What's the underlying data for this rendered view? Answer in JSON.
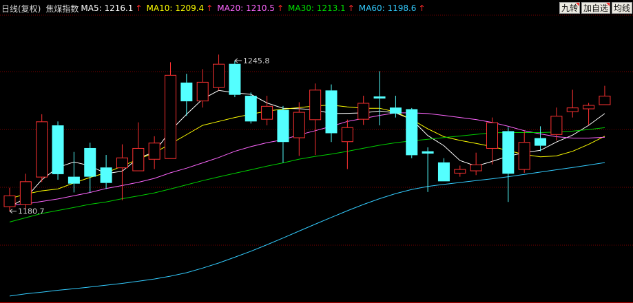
{
  "header": {
    "period": "日线(复权)",
    "name": "焦煤指数",
    "ma": [
      {
        "label": "MA5:",
        "value": "1216.1",
        "color": "#ffffff"
      },
      {
        "label": "MA10:",
        "value": "1209.4",
        "color": "#ffff00"
      },
      {
        "label": "MA20:",
        "value": "1210.5",
        "color": "#ff66ff"
      },
      {
        "label": "MA30:",
        "value": "1213.1",
        "color": "#00e000"
      },
      {
        "label": "MA60:",
        "value": "1198.6",
        "color": "#33ccff"
      }
    ],
    "arrow": "↑"
  },
  "buttons": [
    "九转",
    "加自选",
    "均线"
  ],
  "colors": {
    "up": "#ff3232",
    "down": "#54ffff",
    "grid": "#7a0000",
    "ma5": "#ffffff",
    "ma10": "#ffff00",
    "ma20": "#ff66ff",
    "ma30": "#00d000",
    "ma60": "#33ccff",
    "annotation": "#d0d0d0"
  },
  "chart_data": {
    "type": "candlestick",
    "title": "焦煤指数",
    "ylim": [
      1141,
      1272
    ],
    "grid": "horizontal dotted",
    "annotations": [
      {
        "text": "1245.8",
        "kind": "high",
        "index": 14
      },
      {
        "text": "1180.7",
        "kind": "low",
        "index": 0
      }
    ],
    "candles": [
      {
        "o": 1182.5,
        "c": 1187.5,
        "h": 1190.8,
        "l": 1180.7
      },
      {
        "o": 1183.5,
        "c": 1193.6,
        "h": 1196.9,
        "l": 1181.7
      },
      {
        "o": 1195.3,
        "c": 1219.5,
        "h": 1222.6,
        "l": 1193.3
      },
      {
        "o": 1217.8,
        "c": 1196.7,
        "h": 1219.5,
        "l": 1194.3
      },
      {
        "o": 1195.6,
        "c": 1192.6,
        "h": 1206.3,
        "l": 1188.8
      },
      {
        "o": 1208.0,
        "c": 1195.6,
        "h": 1210.3,
        "l": 1188.8
      },
      {
        "o": 1199.6,
        "c": 1192.9,
        "h": 1205.0,
        "l": 1190.3
      },
      {
        "o": 1199.3,
        "c": 1203.9,
        "h": 1209.6,
        "l": 1185.4
      },
      {
        "o": 1198.0,
        "c": 1208.0,
        "h": 1219.1,
        "l": 1198.0
      },
      {
        "o": 1203.0,
        "c": 1210.3,
        "h": 1213.1,
        "l": 1198.9
      },
      {
        "o": 1203.3,
        "c": 1239.6,
        "h": 1245.1,
        "l": 1203.3
      },
      {
        "o": 1236.3,
        "c": 1228.2,
        "h": 1240.1,
        "l": 1221.9
      },
      {
        "o": 1228.2,
        "c": 1236.6,
        "h": 1242.1,
        "l": 1225.5
      },
      {
        "o": 1234.0,
        "c": 1244.4,
        "h": 1248.4,
        "l": 1232.9
      },
      {
        "o": 1244.4,
        "c": 1231.0,
        "h": 1245.8,
        "l": 1230.0
      },
      {
        "o": 1230.6,
        "c": 1219.5,
        "h": 1232.0,
        "l": 1218.6
      },
      {
        "o": 1220.3,
        "c": 1226.2,
        "h": 1230.6,
        "l": 1217.8
      },
      {
        "o": 1224.5,
        "c": 1210.6,
        "h": 1226.2,
        "l": 1201.6
      },
      {
        "o": 1212.3,
        "c": 1223.6,
        "h": 1227.8,
        "l": 1204.6
      },
      {
        "o": 1220.1,
        "c": 1233.2,
        "h": 1235.9,
        "l": 1205.0
      },
      {
        "o": 1232.9,
        "c": 1214.4,
        "h": 1235.5,
        "l": 1210.6
      },
      {
        "o": 1210.6,
        "c": 1217.0,
        "h": 1220.3,
        "l": 1198.9
      },
      {
        "o": 1220.3,
        "c": 1227.5,
        "h": 1230.6,
        "l": 1218.0
      },
      {
        "o": 1230.3,
        "c": 1229.4,
        "h": 1241.2,
        "l": 1217.8
      },
      {
        "o": 1225.5,
        "c": 1222.9,
        "h": 1230.6,
        "l": 1221.2
      },
      {
        "o": 1224.8,
        "c": 1204.9,
        "h": 1225.3,
        "l": 1203.6
      },
      {
        "o": 1206.6,
        "c": 1205.6,
        "h": 1208.3,
        "l": 1189.0
      },
      {
        "o": 1201.8,
        "c": 1193.6,
        "h": 1203.6,
        "l": 1193.6
      },
      {
        "o": 1197.0,
        "c": 1198.9,
        "h": 1200.4,
        "l": 1195.6
      },
      {
        "o": 1198.0,
        "c": 1200.9,
        "h": 1206.0,
        "l": 1196.3
      },
      {
        "o": 1207.7,
        "c": 1219.1,
        "h": 1221.2,
        "l": 1200.9
      },
      {
        "o": 1215.3,
        "c": 1196.9,
        "h": 1217.0,
        "l": 1184.7
      },
      {
        "o": 1198.6,
        "c": 1210.6,
        "h": 1215.3,
        "l": 1197.3
      },
      {
        "o": 1212.3,
        "c": 1209.0,
        "h": 1217.4,
        "l": 1206.6
      },
      {
        "o": 1213.7,
        "c": 1221.9,
        "h": 1225.5,
        "l": 1211.3
      },
      {
        "o": 1223.6,
        "c": 1225.5,
        "h": 1233.2,
        "l": 1221.2
      },
      {
        "o": 1224.8,
        "c": 1226.6,
        "h": 1227.5,
        "l": 1218.0
      },
      {
        "o": 1226.6,
        "c": 1230.6,
        "h": 1234.9,
        "l": 1226.6
      }
    ],
    "ma_series": [
      {
        "name": "MA5",
        "color_key": "ma5",
        "points": [
          [
            0,
            1182.6
          ],
          [
            1,
            1186.4
          ],
          [
            2,
            1194.3
          ],
          [
            3,
            1199.6
          ],
          [
            4,
            1202.0
          ],
          [
            5,
            1200.3
          ],
          [
            6,
            1196.9
          ],
          [
            7,
            1198.0
          ],
          [
            8,
            1203.6
          ],
          [
            9,
            1206.3
          ],
          [
            10,
            1215.5
          ],
          [
            11,
            1222.6
          ],
          [
            12,
            1229.2
          ],
          [
            13,
            1232.9
          ],
          [
            14,
            1231.9
          ],
          [
            15,
            1231.2
          ],
          [
            16,
            1227.5
          ],
          [
            17,
            1225.2
          ],
          [
            18,
            1225.0
          ],
          [
            19,
            1224.5
          ],
          [
            20,
            1222.9
          ],
          [
            21,
            1223.0
          ],
          [
            22,
            1223.2
          ],
          [
            23,
            1224.0
          ],
          [
            24,
            1223.2
          ],
          [
            25,
            1220.3
          ],
          [
            26,
            1213.4
          ],
          [
            27,
            1209.0
          ],
          [
            28,
            1202.6
          ],
          [
            29,
            1200.2
          ],
          [
            30,
            1202.2
          ],
          [
            31,
            1204.5
          ],
          [
            32,
            1206.0
          ],
          [
            33,
            1207.0
          ],
          [
            34,
            1210.6
          ],
          [
            35,
            1213.6
          ],
          [
            36,
            1217.8
          ],
          [
            37,
            1222.9
          ]
        ]
      },
      {
        "name": "MA10",
        "color_key": "ma10",
        "points": [
          [
            0,
            1186.1
          ],
          [
            1,
            1188.1
          ],
          [
            2,
            1189.5
          ],
          [
            3,
            1190.3
          ],
          [
            4,
            1192.9
          ],
          [
            5,
            1195.3
          ],
          [
            6,
            1197.3
          ],
          [
            7,
            1200.2
          ],
          [
            8,
            1203.2
          ],
          [
            9,
            1206.0
          ],
          [
            10,
            1209.8
          ],
          [
            11,
            1213.8
          ],
          [
            12,
            1217.8
          ],
          [
            13,
            1219.5
          ],
          [
            14,
            1221.2
          ],
          [
            15,
            1222.6
          ],
          [
            16,
            1224.0
          ],
          [
            17,
            1224.8
          ],
          [
            18,
            1225.5
          ],
          [
            19,
            1226.2
          ],
          [
            20,
            1226.6
          ],
          [
            21,
            1225.8
          ],
          [
            22,
            1225.2
          ],
          [
            23,
            1225.2
          ],
          [
            24,
            1223.6
          ],
          [
            25,
            1220.3
          ],
          [
            26,
            1216.3
          ],
          [
            27,
            1212.9
          ],
          [
            28,
            1211.3
          ],
          [
            29,
            1210.0
          ],
          [
            30,
            1208.6
          ],
          [
            31,
            1206.9
          ],
          [
            32,
            1205.2
          ],
          [
            33,
            1204.2
          ],
          [
            34,
            1204.6
          ],
          [
            35,
            1206.6
          ],
          [
            36,
            1209.6
          ],
          [
            37,
            1213.1
          ]
        ]
      },
      {
        "name": "MA20",
        "color_key": "ma20",
        "points": [
          [
            0,
            1183.3
          ],
          [
            1,
            1183.8
          ],
          [
            2,
            1184.9
          ],
          [
            3,
            1186.0
          ],
          [
            4,
            1187.4
          ],
          [
            5,
            1188.8
          ],
          [
            6,
            1190.5
          ],
          [
            7,
            1191.8
          ],
          [
            8,
            1193.2
          ],
          [
            9,
            1194.9
          ],
          [
            10,
            1197.3
          ],
          [
            11,
            1199.3
          ],
          [
            12,
            1201.6
          ],
          [
            13,
            1203.9
          ],
          [
            14,
            1206.6
          ],
          [
            15,
            1208.6
          ],
          [
            16,
            1210.3
          ],
          [
            17,
            1211.6
          ],
          [
            18,
            1213.7
          ],
          [
            19,
            1215.5
          ],
          [
            20,
            1217.4
          ],
          [
            21,
            1219.5
          ],
          [
            22,
            1220.8
          ],
          [
            23,
            1222.1
          ],
          [
            24,
            1223.2
          ],
          [
            25,
            1223.2
          ],
          [
            26,
            1222.9
          ],
          [
            27,
            1222.1
          ],
          [
            28,
            1221.2
          ],
          [
            29,
            1220.3
          ],
          [
            30,
            1219.1
          ],
          [
            31,
            1217.4
          ],
          [
            32,
            1215.5
          ],
          [
            33,
            1214.1
          ],
          [
            34,
            1212.9
          ],
          [
            35,
            1212.3
          ],
          [
            36,
            1212.3
          ],
          [
            37,
            1212.7
          ]
        ]
      },
      {
        "name": "MA30",
        "color_key": "ma30",
        "points": [
          [
            0,
            1176.0
          ],
          [
            1,
            1177.9
          ],
          [
            2,
            1179.7
          ],
          [
            3,
            1181.0
          ],
          [
            4,
            1182.3
          ],
          [
            5,
            1183.7
          ],
          [
            6,
            1184.7
          ],
          [
            7,
            1186.1
          ],
          [
            8,
            1187.3
          ],
          [
            9,
            1188.6
          ],
          [
            10,
            1190.3
          ],
          [
            11,
            1192.1
          ],
          [
            12,
            1193.9
          ],
          [
            13,
            1195.5
          ],
          [
            14,
            1197.1
          ],
          [
            15,
            1198.6
          ],
          [
            16,
            1200.2
          ],
          [
            17,
            1201.6
          ],
          [
            18,
            1203.2
          ],
          [
            19,
            1204.4
          ],
          [
            20,
            1205.4
          ],
          [
            21,
            1206.6
          ],
          [
            22,
            1207.9
          ],
          [
            23,
            1209.2
          ],
          [
            24,
            1210.3
          ],
          [
            25,
            1211.1
          ],
          [
            26,
            1211.8
          ],
          [
            27,
            1212.5
          ],
          [
            28,
            1213.2
          ],
          [
            29,
            1213.9
          ],
          [
            30,
            1214.6
          ],
          [
            31,
            1214.7
          ],
          [
            32,
            1214.7
          ],
          [
            33,
            1214.7
          ],
          [
            34,
            1214.9
          ],
          [
            35,
            1215.3
          ],
          [
            36,
            1216.0
          ],
          [
            37,
            1216.8
          ]
        ]
      },
      {
        "name": "MA60",
        "color_key": "ma60",
        "points": [
          [
            0,
            1144.0
          ],
          [
            1,
            1145.0
          ],
          [
            2,
            1145.7
          ],
          [
            3,
            1146.5
          ],
          [
            4,
            1147.2
          ],
          [
            5,
            1147.9
          ],
          [
            6,
            1148.7
          ],
          [
            7,
            1149.5
          ],
          [
            8,
            1150.4
          ],
          [
            9,
            1151.4
          ],
          [
            10,
            1152.6
          ],
          [
            11,
            1154.1
          ],
          [
            12,
            1156.1
          ],
          [
            13,
            1158.3
          ],
          [
            14,
            1160.8
          ],
          [
            15,
            1163.4
          ],
          [
            16,
            1166.2
          ],
          [
            17,
            1169.1
          ],
          [
            18,
            1172.1
          ],
          [
            19,
            1175.1
          ],
          [
            20,
            1178.0
          ],
          [
            21,
            1180.9
          ],
          [
            22,
            1183.6
          ],
          [
            23,
            1186.1
          ],
          [
            24,
            1188.3
          ],
          [
            25,
            1190.1
          ],
          [
            26,
            1191.4
          ],
          [
            27,
            1192.3
          ],
          [
            28,
            1193.1
          ],
          [
            29,
            1193.9
          ],
          [
            30,
            1194.7
          ],
          [
            31,
            1195.6
          ],
          [
            32,
            1196.6
          ],
          [
            33,
            1197.6
          ],
          [
            34,
            1198.6
          ],
          [
            35,
            1199.6
          ],
          [
            36,
            1200.6
          ],
          [
            37,
            1201.7
          ]
        ]
      }
    ]
  }
}
